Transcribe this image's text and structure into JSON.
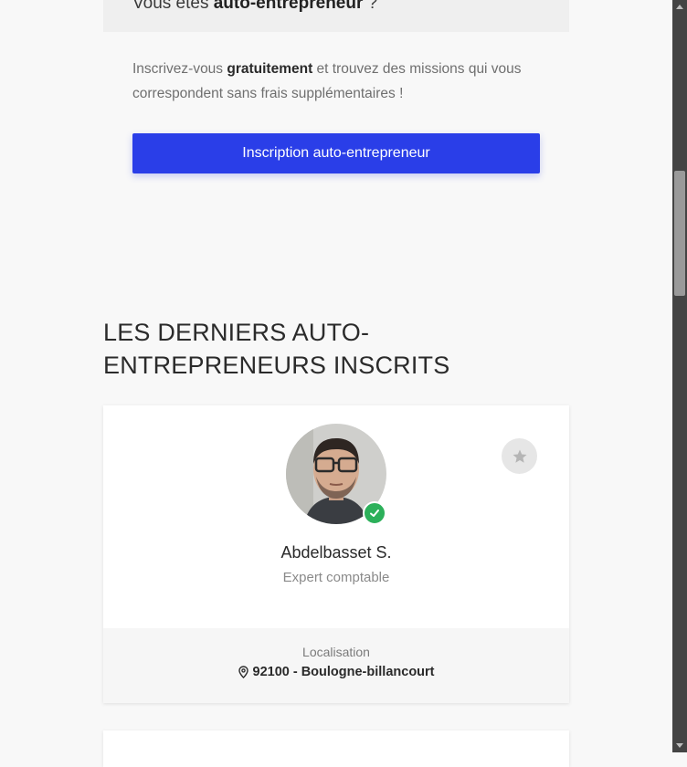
{
  "banner": {
    "question_prefix": "Vous êtes ",
    "question_bold": "auto-entrepreneur",
    "question_suffix": " ?"
  },
  "promo": {
    "prefix": "Inscrivez-vous ",
    "bold": "gratuitement",
    "suffix": " et trouvez des missions qui vous correspondent sans frais supplémentaires !"
  },
  "cta": {
    "label": "Inscription auto-entrepreneur"
  },
  "section": {
    "title": "LES DERNIERS AUTO-ENTREPRENEURS INSCRITS"
  },
  "profile_card": {
    "name": "Abdelbasset S.",
    "job": "Expert comptable",
    "location_label": "Localisation",
    "location_value": "92100 - Boulogne-billancourt",
    "verified": true
  },
  "colors": {
    "primary": "#2a3ee8",
    "verified": "#2cb05a"
  }
}
